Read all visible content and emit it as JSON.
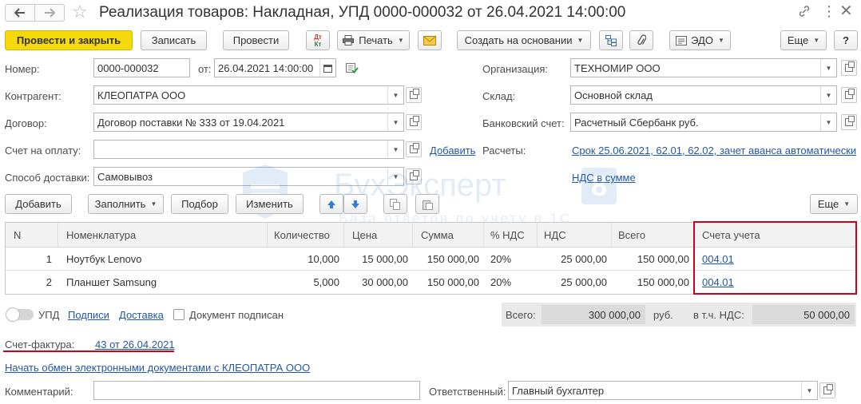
{
  "window": {
    "title": "Реализация товаров: Накладная, УПД 0000-000032 от 26.04.2021 14:00:00"
  },
  "toolbar": {
    "post_and_close": "Провести и закрыть",
    "save": "Записать",
    "post": "Провести",
    "dtkt_top": "Дт",
    "dtkt_bottom": "Кт",
    "print": "Печать",
    "create_based_on": "Создать на основании",
    "edo": "ЭДО",
    "more": "Еще",
    "help": "?"
  },
  "form": {
    "number_label": "Номер:",
    "number_value": "0000-000032",
    "from_label": "от:",
    "date_value": "26.04.2021 14:00:00",
    "organization_label": "Организация:",
    "organization_value": "ТЕХНОМИР ООО",
    "contractor_label": "Контрагент:",
    "contractor_value": "КЛЕОПАТРА ООО",
    "warehouse_label": "Склад:",
    "warehouse_value": "Основной склад",
    "contract_label": "Договор:",
    "contract_value": "Договор поставки № 333 от 19.04.2021",
    "bank_account_label": "Банковский счет:",
    "bank_account_value": "Расчетный Сбербанк руб.",
    "invoice_for_payment_label": "Счет на оплату:",
    "invoice_for_payment_value": "",
    "add_link": "Добавить",
    "settlements_label": "Расчеты:",
    "settlements_link": "Срок 25.06.2021, 62.01, 62.02, зачет аванса автоматически",
    "delivery_label": "Способ доставки:",
    "delivery_value": "Самовывоз",
    "vat_link": "НДС в сумме"
  },
  "table_toolbar": {
    "add": "Добавить",
    "fill": "Заполнить",
    "select": "Подбор",
    "change": "Изменить",
    "more": "Еще"
  },
  "table": {
    "columns": [
      "N",
      "Номенклатура",
      "Количество",
      "Цена",
      "Сумма",
      "% НДС",
      "НДС",
      "Всего",
      "Счета учета"
    ],
    "rows": [
      {
        "n": "1",
        "item": "Ноутбук Lenovo",
        "qty": "10,000",
        "price": "15 000,00",
        "sum": "150 000,00",
        "vat_rate": "20%",
        "vat": "25 000,00",
        "total": "150 000,00",
        "account": "004.01"
      },
      {
        "n": "2",
        "item": "Планшет Samsung",
        "qty": "5,000",
        "price": "30 000,00",
        "sum": "150 000,00",
        "vat_rate": "20%",
        "vat": "25 000,00",
        "total": "150 000,00",
        "account": "004.01"
      }
    ]
  },
  "footer": {
    "upd_label": "УПД",
    "signatures_link": "Подписи",
    "delivery_link": "Доставка",
    "doc_signed_label": "Документ подписан",
    "total_label": "Всего:",
    "total_value": "300 000,00",
    "currency": "руб.",
    "incl_vat_label": "в т.ч. НДС:",
    "incl_vat_value": "50 000,00",
    "invoice_label": "Счет-фактура:",
    "invoice_link": "43 от 26.04.2021",
    "edo_exchange_link": "Начать обмен электронными документами с КЛЕОПАТРА ООО",
    "comment_label": "Комментарий:",
    "comment_value": "",
    "responsible_label": "Ответственный:",
    "responsible_value": "Главный бухгалтер"
  },
  "watermark": {
    "brand": "БухЭксперт",
    "digit": "8",
    "tagline": "База ответов по учету в 1С"
  },
  "colors": {
    "primary_button": "#f5d90a",
    "link": "#2357a6",
    "highlight_border": "#d0021b",
    "underline_red": "#d0021b"
  }
}
